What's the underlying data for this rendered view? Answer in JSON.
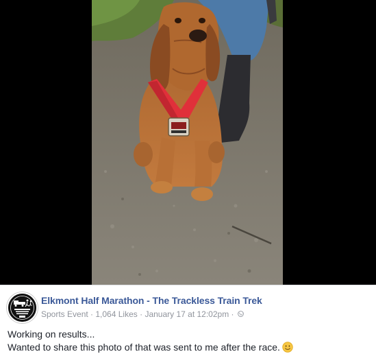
{
  "post": {
    "page_name": "Elkmont Half Marathon - The Trackless Train Trek",
    "category": "Sports Event",
    "separator": " · ",
    "likes": "1,064 Likes",
    "timestamp": "January 17 at 12:02pm",
    "privacy_icon": "globe-icon",
    "body_line_1": "Working on results...",
    "body_line_2": "Wanted to share this photo of that was sent to me after the race.",
    "emoji_icon": "smile-emoji-icon"
  },
  "photo": {
    "subject": "dog-wearing-medal-photo",
    "medal_ribbon_color": "#e0303a"
  },
  "colors": {
    "link_blue": "#3b5998",
    "meta_gray": "#90949c",
    "text": "#1d2129",
    "backdrop": "#000000"
  }
}
